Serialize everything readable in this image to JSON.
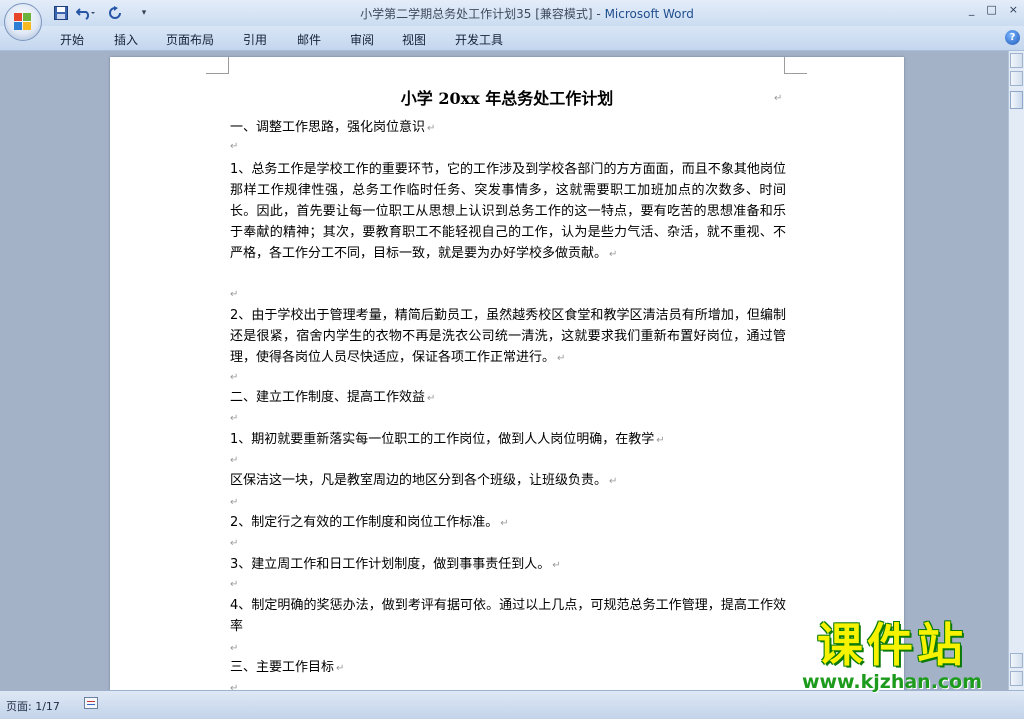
{
  "window": {
    "title": "小学第二学期总务处工作计划35 [兼容模式] - ",
    "app_name": "Microsoft Word",
    "controls": {
      "minimize": "_",
      "restore": "□",
      "close": "×"
    }
  },
  "quick_access": {
    "more": "▾"
  },
  "ribbon": {
    "tabs": [
      "开始",
      "插入",
      "页面布局",
      "引用",
      "邮件",
      "审阅",
      "视图",
      "开发工具"
    ],
    "help": "?"
  },
  "document": {
    "title": "小学 20xx 年总务处工作计划",
    "paragraphs": [
      "一、调整工作思路，强化岗位意识",
      "1、总务工作是学校工作的重要环节，它的工作涉及到学校各部门的方方面面，而且不象其他岗位那样工作规律性强，总务工作临时任务、突发事情多，这就需要职工加班加点的次数多、时间长。因此，首先要让每一位职工从思想上认识到总务工作的这一特点，要有吃苦的思想准备和乐于奉献的精神；其次，要教育职工不能轻视自己的工作，认为是些力气活、杂活，就不重视、不严格，各工作分工不同，目标一致，就是要为办好学校多做贡献。",
      "2、由于学校出于管理考量，精简后勤员工，虽然越秀校区食堂和教学区清洁员有所增加，但编制还是很紧，宿舍内学生的衣物不再是洗衣公司统一清洗，这就要求我们重新布置好岗位，通过管理，使得各岗位人员尽快适应，保证各项工作正常进行。",
      "二、建立工作制度、提高工作效益",
      "1、期初就要重新落实每一位职工的工作岗位，做到人人岗位明确，在教学",
      "区保洁这一块，凡是教室周边的地区分到各个班级，让班级负责。",
      "2、制定行之有效的工作制度和岗位工作标准。",
      "3、建立周工作和日工作计划制度，做到事事责任到人。",
      "4、制定明确的奖惩办法，做到考评有据可依。通过以上几点，可规范总务工作管理，提高工作效率",
      "三、主要工作目标"
    ],
    "paragraph_mark": "↵"
  },
  "status": {
    "page": "页面: 1/17"
  },
  "watermark": {
    "brand": "课件站",
    "url": "www.kjzhan.com"
  }
}
